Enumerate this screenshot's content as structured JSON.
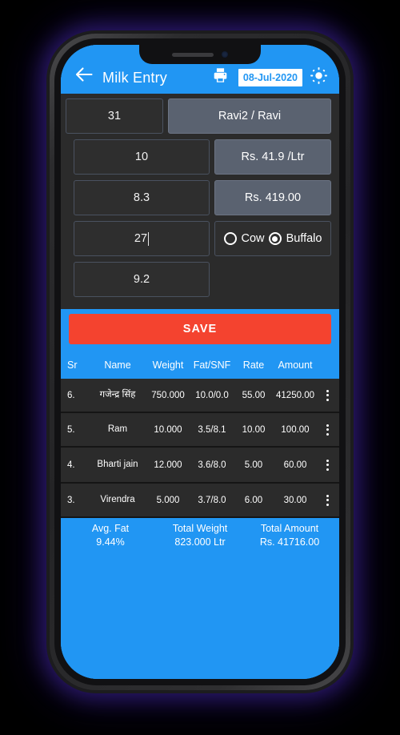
{
  "appbar": {
    "back_icon": "arrow-left-icon",
    "title": "Milk Entry",
    "print_icon": "printer-icon",
    "date": "08-Jul-2020",
    "brightness_icon": "sun-icon"
  },
  "form": {
    "code_value": "31",
    "member_value": "Ravi2 / Ravi",
    "fat_value": "10",
    "rate_value": "Rs. 41.9 /Ltr",
    "snf_value": "8.3",
    "amount_value": "Rs. 419.00",
    "weight_value": "27",
    "clr_value": "9.2",
    "animal": {
      "cow_label": "Cow",
      "buffalo_label": "Buffalo",
      "selected": "Buffalo"
    },
    "save_label": "SAVE"
  },
  "table": {
    "headers": [
      "Sr",
      "Name",
      "Weight",
      "Fat/SNF",
      "Rate",
      "Amount"
    ],
    "rows": [
      {
        "sr": "6.",
        "name": "गजेन्द्र सिंह",
        "weight": "750.000",
        "fatsnf": "10.0/0.0",
        "rate": "55.00",
        "amount": "41250.00",
        "menu_icon": "more-vertical-icon"
      },
      {
        "sr": "5.",
        "name": "Ram",
        "weight": "10.000",
        "fatsnf": "3.5/8.1",
        "rate": "10.00",
        "amount": "100.00",
        "menu_icon": "more-vertical-icon"
      },
      {
        "sr": "4.",
        "name": "Bharti jain",
        "weight": "12.000",
        "fatsnf": "3.6/8.0",
        "rate": "5.00",
        "amount": "60.00",
        "menu_icon": "more-vertical-icon"
      },
      {
        "sr": "3.",
        "name": "Virendra",
        "weight": "5.000",
        "fatsnf": "3.7/8.0",
        "rate": "6.00",
        "amount": "30.00",
        "menu_icon": "more-vertical-icon"
      }
    ]
  },
  "summary": {
    "avg_fat_label": "Avg. Fat",
    "avg_fat_value": "9.44%",
    "total_weight_label": "Total Weight",
    "total_weight_value": "823.000 Ltr",
    "total_amount_label": "Total Amount",
    "total_amount_value": "Rs. 41716.00"
  },
  "colors": {
    "accent_blue": "#2196f3",
    "save_red": "#f4432f",
    "field_dark": "#2e2e2e",
    "chip_grey": "#5a6270",
    "body_dark": "#2b2b2b"
  }
}
